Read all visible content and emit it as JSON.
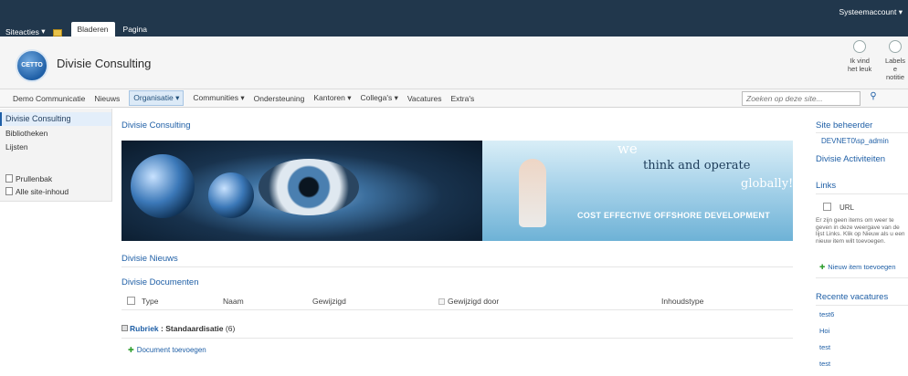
{
  "ribbon": {
    "site_actions": "Siteacties",
    "tab_browse": "Bladeren",
    "tab_page": "Pagina",
    "account": "Systeemaccount"
  },
  "header": {
    "logo_text": "CETTO",
    "title": "Divisie Consulting",
    "like_label_1": "Ik vind",
    "like_label_2": "het leuk",
    "tags_label_1": "Labels e",
    "tags_label_2": "notitie"
  },
  "topnav": {
    "items": [
      "Demo Communicatie",
      "Nieuws",
      "Organisatie",
      "Communities",
      "Ondersteuning",
      "Kantoren",
      "Collega's",
      "Vacatures",
      "Extra's"
    ],
    "search_placeholder": "Zoeken op deze site..."
  },
  "leftnav": {
    "current": "Divisie Consulting",
    "libraries": "Bibliotheken",
    "lists": "Lijsten",
    "recycle": "Prullenbak",
    "all_content": "Alle site-inhoud"
  },
  "main": {
    "title": "Divisie Consulting",
    "banner": {
      "we": "we",
      "think": "think and operate",
      "globally": "globally!",
      "cost": "COST EFFECTIVE OFFSHORE DEVELOPMENT"
    },
    "news_title": "Divisie Nieuws",
    "docs_title": "Divisie Documenten",
    "columns": [
      "Type",
      "Naam",
      "Gewijzigd",
      "Gewijzigd door",
      "Inhoudstype"
    ],
    "group_label": "Rubriek",
    "group_value": "Standaardisatie",
    "group_count": "(6)",
    "add_doc": "Document toevoegen"
  },
  "right": {
    "site_admin_title": "Site beheerder",
    "site_admin_user": "DEVNET0\\sp_admin",
    "activities_title": "Divisie Activiteiten",
    "links_title": "Links",
    "url_col": "URL",
    "empty_msg": "Er zijn geen items om weer te geven in deze weergave van de lijst Links. Klik op Nieuw als u een nieuw item wilt toevoegen.",
    "new_item": "Nieuw item toevoegen",
    "vacancies_title": "Recente vacatures",
    "vacancies": [
      "test6",
      "Hoi",
      "test",
      "test"
    ]
  }
}
